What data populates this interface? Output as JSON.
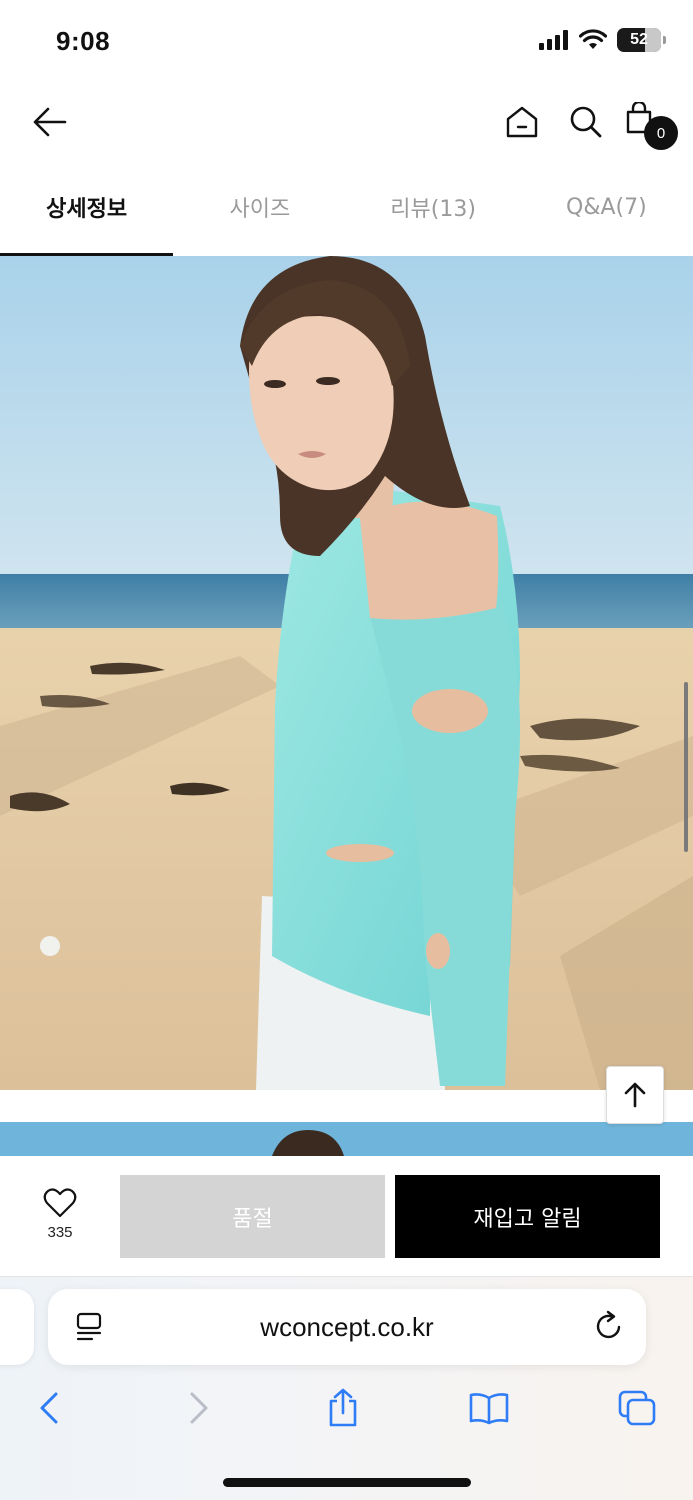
{
  "status_bar": {
    "time": "9:08",
    "battery": "52"
  },
  "header": {
    "back_icon": "arrow-left-icon",
    "home_icon": "home-icon",
    "search_icon": "search-icon",
    "cart_icon": "shopping-bag-icon",
    "cart_count": "0"
  },
  "tabs": [
    {
      "label": "상세정보",
      "active": true
    },
    {
      "label": "사이즈",
      "active": false
    },
    {
      "label": "리뷰(13)",
      "active": false
    },
    {
      "label": "Q&A(7)",
      "active": false
    }
  ],
  "purchase": {
    "like_icon": "heart-outline-icon",
    "like_count": "335",
    "soldout_label": "품절",
    "restock_label": "재입고 알림"
  },
  "browser": {
    "url": "wconcept.co.kr",
    "reader_icon": "page-format-icon",
    "reload_icon": "reload-icon",
    "toolbar": [
      "back-icon",
      "forward-icon",
      "share-icon",
      "bookmarks-icon",
      "tabs-icon"
    ]
  },
  "colors": {
    "accent": "#000000",
    "soldout": "#d4d4d4",
    "safari_blue": "#2f7df6"
  }
}
